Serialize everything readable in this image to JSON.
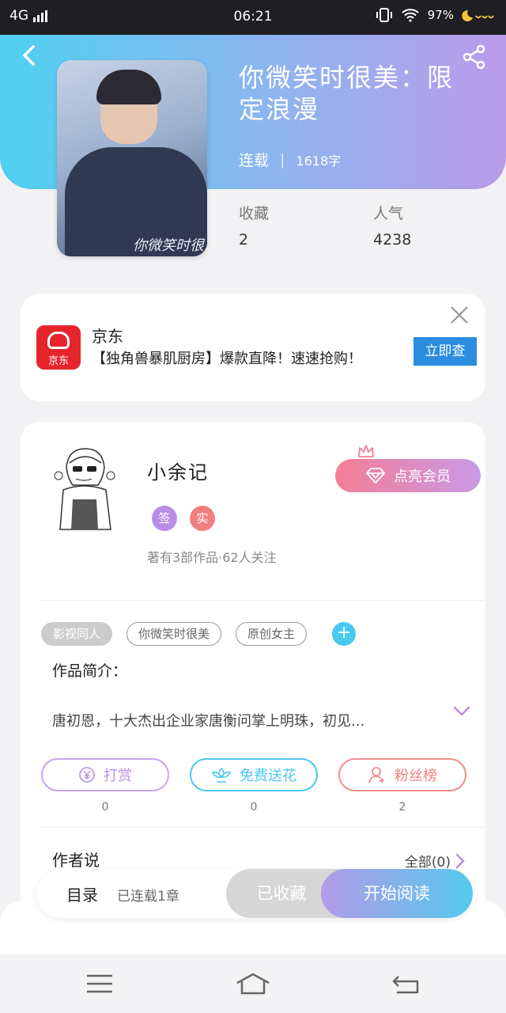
{
  "status_bar": {
    "network": "4G",
    "time": "06:21",
    "battery": "97%"
  },
  "header": {
    "title": "你微笑时很美：限定浪漫",
    "status": "连载",
    "words": "1618字",
    "stats": [
      {
        "label": "收藏",
        "value": "2"
      },
      {
        "label": "人气",
        "value": "4238"
      }
    ]
  },
  "cover": {
    "caption": "你微笑时很美"
  },
  "ad": {
    "brand": "京东",
    "logo_text": "京东",
    "text": "【独角兽暴肌厨房】爆款直降！速速抢购！",
    "cta": "立即查"
  },
  "author": {
    "name": "小余记",
    "badges": [
      {
        "text": "签",
        "color": "#b98de6"
      },
      {
        "text": "实",
        "color": "#f08080"
      }
    ],
    "stats": "著有3部作品·62人关注",
    "vip_button": "点亮会员"
  },
  "tags": [
    "影视同人",
    "你微笑时很美",
    "原创女主"
  ],
  "intro": {
    "title": "作品简介：",
    "text": "唐初恩，十大杰出企业家唐衡问掌上明珠，初见..."
  },
  "actions": [
    {
      "label": "打赏",
      "count": "0",
      "color": "#b98de6",
      "icon": "yen-icon"
    },
    {
      "label": "免费送花",
      "count": "0",
      "color": "#4cc7ef",
      "icon": "flower-icon"
    },
    {
      "label": "粉丝榜",
      "count": "2",
      "color": "#ef8080",
      "icon": "fan-icon"
    }
  ],
  "author_say": {
    "title": "作者说",
    "all": "全部(0)"
  },
  "read_bar": {
    "toc": "目录",
    "toc_status": "已连载1章",
    "collected": "已收藏",
    "start": "开始阅读"
  }
}
